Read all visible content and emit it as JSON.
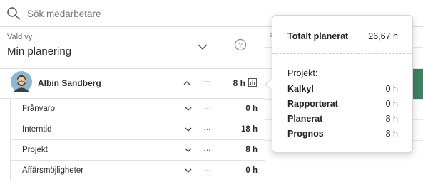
{
  "search": {
    "placeholder": "Sök medarbetare"
  },
  "view": {
    "label": "Vald vy",
    "value": "Min planering"
  },
  "header_fragment": "s",
  "person": {
    "name": "Albin Sandberg",
    "hours": "8 h",
    "more": "···"
  },
  "categories": [
    {
      "label": "Frånvaro",
      "hours": "0 h",
      "more": "···"
    },
    {
      "label": "Interntid",
      "hours": "18 h",
      "more": "···"
    },
    {
      "label": "Projekt",
      "hours": "8 h",
      "more": "···"
    },
    {
      "label": "Affärsmöjligheter",
      "hours": "0 h",
      "more": "···"
    }
  ],
  "tooltip": {
    "total_label": "Totalt planerat",
    "total_value": "26,67 h",
    "section_title": "Projekt:",
    "rows": [
      {
        "label": "Kalkyl",
        "value": "0 h"
      },
      {
        "label": "Rapporterat",
        "value": "0 h"
      },
      {
        "label": "Planerat",
        "value": "8 h"
      },
      {
        "label": "Prognos",
        "value": "8 h"
      }
    ]
  },
  "colors": {
    "accent_green": "#3f7f5f",
    "border": "#dcdcdc",
    "text": "#2b2b2b"
  }
}
